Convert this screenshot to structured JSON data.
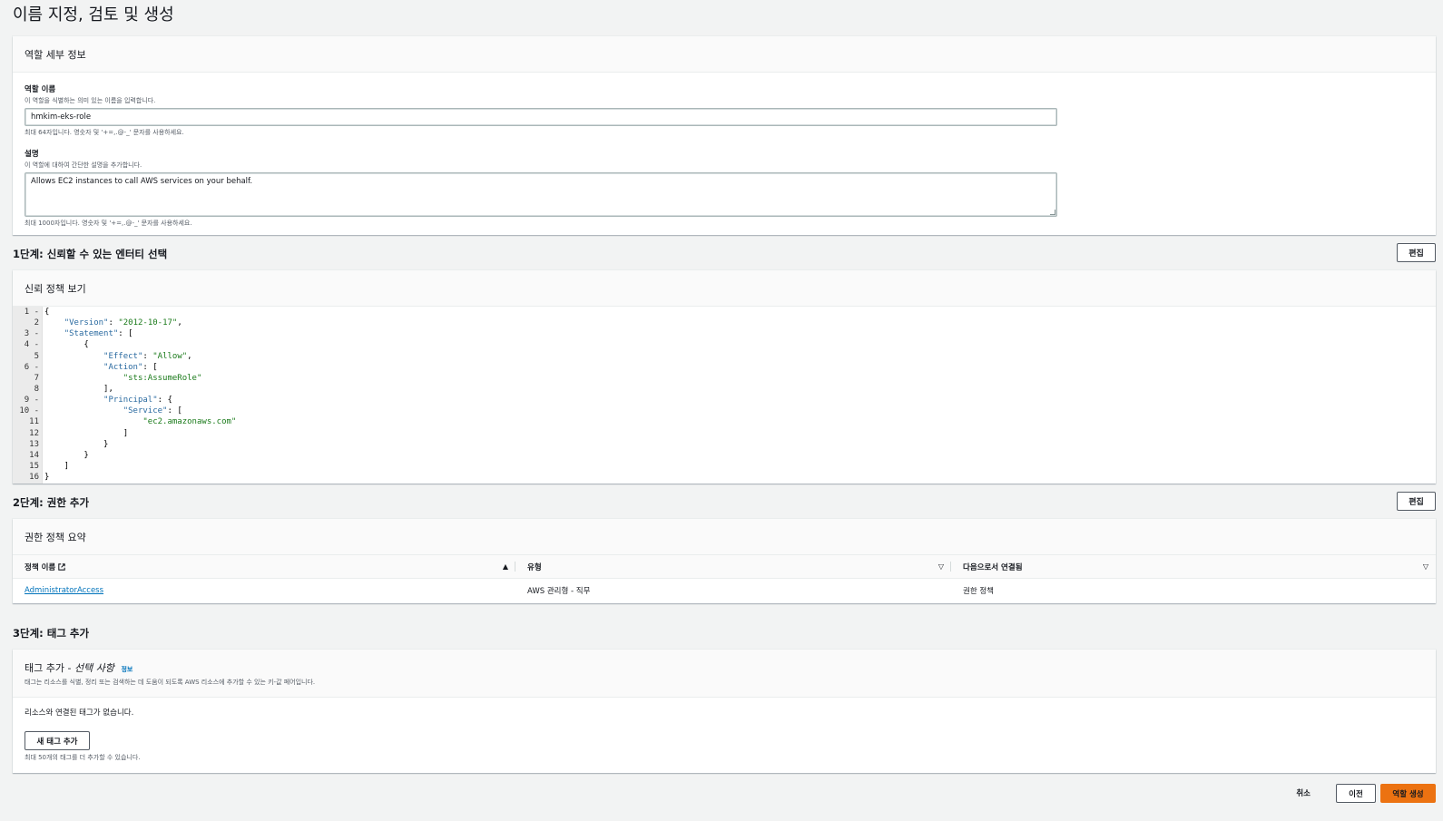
{
  "page": {
    "title": "이름 지정, 검토 및 생성"
  },
  "role_details": {
    "header": "역할 세부 정보",
    "name_label": "역할 이름",
    "name_desc": "이 역할을 식별하는 의미 있는 이름을 입력합니다.",
    "name_value": "hmkim-eks-role",
    "name_hint": "최대 64자입니다. 영숫자 및 '+=,.@-_' 문자를 사용하세요.",
    "desc_label": "설명",
    "desc_desc": "이 역할에 대하여 간단한 설명을 추가합니다.",
    "desc_value": "Allows EC2 instances to call AWS services on your behalf.",
    "desc_hint": "최대 1000자입니다. 영숫자 및 '+=,.@-_' 문자를 사용하세요."
  },
  "step1": {
    "title": "1단계: 신뢰할 수 있는 엔터티 선택",
    "edit_label": "편집",
    "panel_header": "신뢰 정책 보기",
    "gutter": [
      "1 -",
      "2",
      "3 -",
      "4 -",
      "5",
      "6 -",
      "7",
      "8",
      "9 -",
      "10 -",
      "11",
      "12",
      "13",
      "14",
      "15",
      "16"
    ],
    "code_lines": [
      [
        {
          "t": "{",
          "c": ""
        }
      ],
      [
        {
          "t": "    ",
          "c": ""
        },
        {
          "t": "\"Version\"",
          "c": "k"
        },
        {
          "t": ": ",
          "c": ""
        },
        {
          "t": "\"2012-10-17\"",
          "c": "s"
        },
        {
          "t": ",",
          "c": ""
        }
      ],
      [
        {
          "t": "    ",
          "c": ""
        },
        {
          "t": "\"Statement\"",
          "c": "k"
        },
        {
          "t": ": [",
          "c": ""
        }
      ],
      [
        {
          "t": "        {",
          "c": ""
        }
      ],
      [
        {
          "t": "            ",
          "c": ""
        },
        {
          "t": "\"Effect\"",
          "c": "k"
        },
        {
          "t": ": ",
          "c": ""
        },
        {
          "t": "\"Allow\"",
          "c": "s"
        },
        {
          "t": ",",
          "c": ""
        }
      ],
      [
        {
          "t": "            ",
          "c": ""
        },
        {
          "t": "\"Action\"",
          "c": "k"
        },
        {
          "t": ": [",
          "c": ""
        }
      ],
      [
        {
          "t": "                ",
          "c": ""
        },
        {
          "t": "\"sts:AssumeRole\"",
          "c": "s"
        }
      ],
      [
        {
          "t": "            ],",
          "c": ""
        }
      ],
      [
        {
          "t": "            ",
          "c": ""
        },
        {
          "t": "\"Principal\"",
          "c": "k"
        },
        {
          "t": ": {",
          "c": ""
        }
      ],
      [
        {
          "t": "                ",
          "c": ""
        },
        {
          "t": "\"Service\"",
          "c": "k"
        },
        {
          "t": ": [",
          "c": ""
        }
      ],
      [
        {
          "t": "                    ",
          "c": ""
        },
        {
          "t": "\"ec2.amazonaws.com\"",
          "c": "s"
        }
      ],
      [
        {
          "t": "                ]",
          "c": ""
        }
      ],
      [
        {
          "t": "            }",
          "c": ""
        }
      ],
      [
        {
          "t": "        }",
          "c": ""
        }
      ],
      [
        {
          "t": "    ]",
          "c": ""
        }
      ],
      [
        {
          "t": "}",
          "c": ""
        }
      ]
    ]
  },
  "step2": {
    "title": "2단계: 권한 추가",
    "edit_label": "편집",
    "panel_header": "권한 정책 요약",
    "columns": [
      "정책 이름",
      "유형",
      "다음으로서 연결됨"
    ],
    "sort_icons": [
      "▲",
      "▽",
      "▽"
    ],
    "rows": [
      {
        "name": "AdministratorAccess",
        "type": "AWS 관리형 - 직무",
        "attached": "권한 정책"
      }
    ]
  },
  "step3": {
    "title": "3단계: 태그 추가",
    "panel_title": "태그 추가 - ",
    "panel_title_optional": "선택 사항",
    "info_link": "정보",
    "panel_desc": "태그는 리소스를 식별, 정리 또는 검색하는 데 도움이 되도록 AWS 리소스에 추가할 수 있는 키-값 페어입니다.",
    "empty_text": "리소스와 연결된 태그가 없습니다.",
    "add_tag_label": "새 태그 추가",
    "limit_hint": "최대 50개의 태그를 더 추가할 수 있습니다."
  },
  "footer": {
    "cancel_label": "취소",
    "prev_label": "이전",
    "create_label": "역할 생성"
  },
  "colors": {
    "primary": "#ec7211",
    "link": "#0073bb",
    "background": "#f2f3f3"
  }
}
